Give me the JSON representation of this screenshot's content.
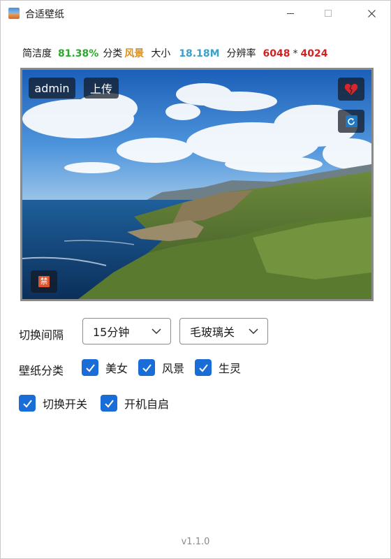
{
  "window": {
    "title": "合适壁纸",
    "icons": [
      "minimize-icon",
      "maximize-icon",
      "close-icon"
    ]
  },
  "info": {
    "clarity_label": "简洁度",
    "clarity_value": "81.38%",
    "category_label": "分类",
    "category_value": "风景",
    "size_label": "大小",
    "size_value": "18.18M",
    "resolution_label": "分辨率",
    "res_width": "6048",
    "res_sep": "*",
    "res_height": "4024"
  },
  "preview": {
    "admin_label": "admin",
    "upload_label": "上传",
    "ban_label": "禁",
    "icons": [
      "broken-heart-icon",
      "refresh-icon",
      "ban-icon"
    ]
  },
  "settings": {
    "interval_label": "切换间隔",
    "interval_value": "15分钟",
    "effect_value": "毛玻璃关",
    "category_label": "壁纸分类",
    "categories": [
      {
        "label": "美女",
        "checked": true
      },
      {
        "label": "风景",
        "checked": true
      },
      {
        "label": "生灵",
        "checked": true
      }
    ],
    "switch_label": "切换开关",
    "switch_checked": true,
    "autostart_label": "开机自启",
    "autostart_checked": true
  },
  "version": "v1.1.0",
  "colors": {
    "checkbox": "#1a6dd6",
    "green": "#2aaa2a",
    "orange": "#e0901b",
    "blue": "#3aa1c8",
    "red": "#d62121"
  }
}
